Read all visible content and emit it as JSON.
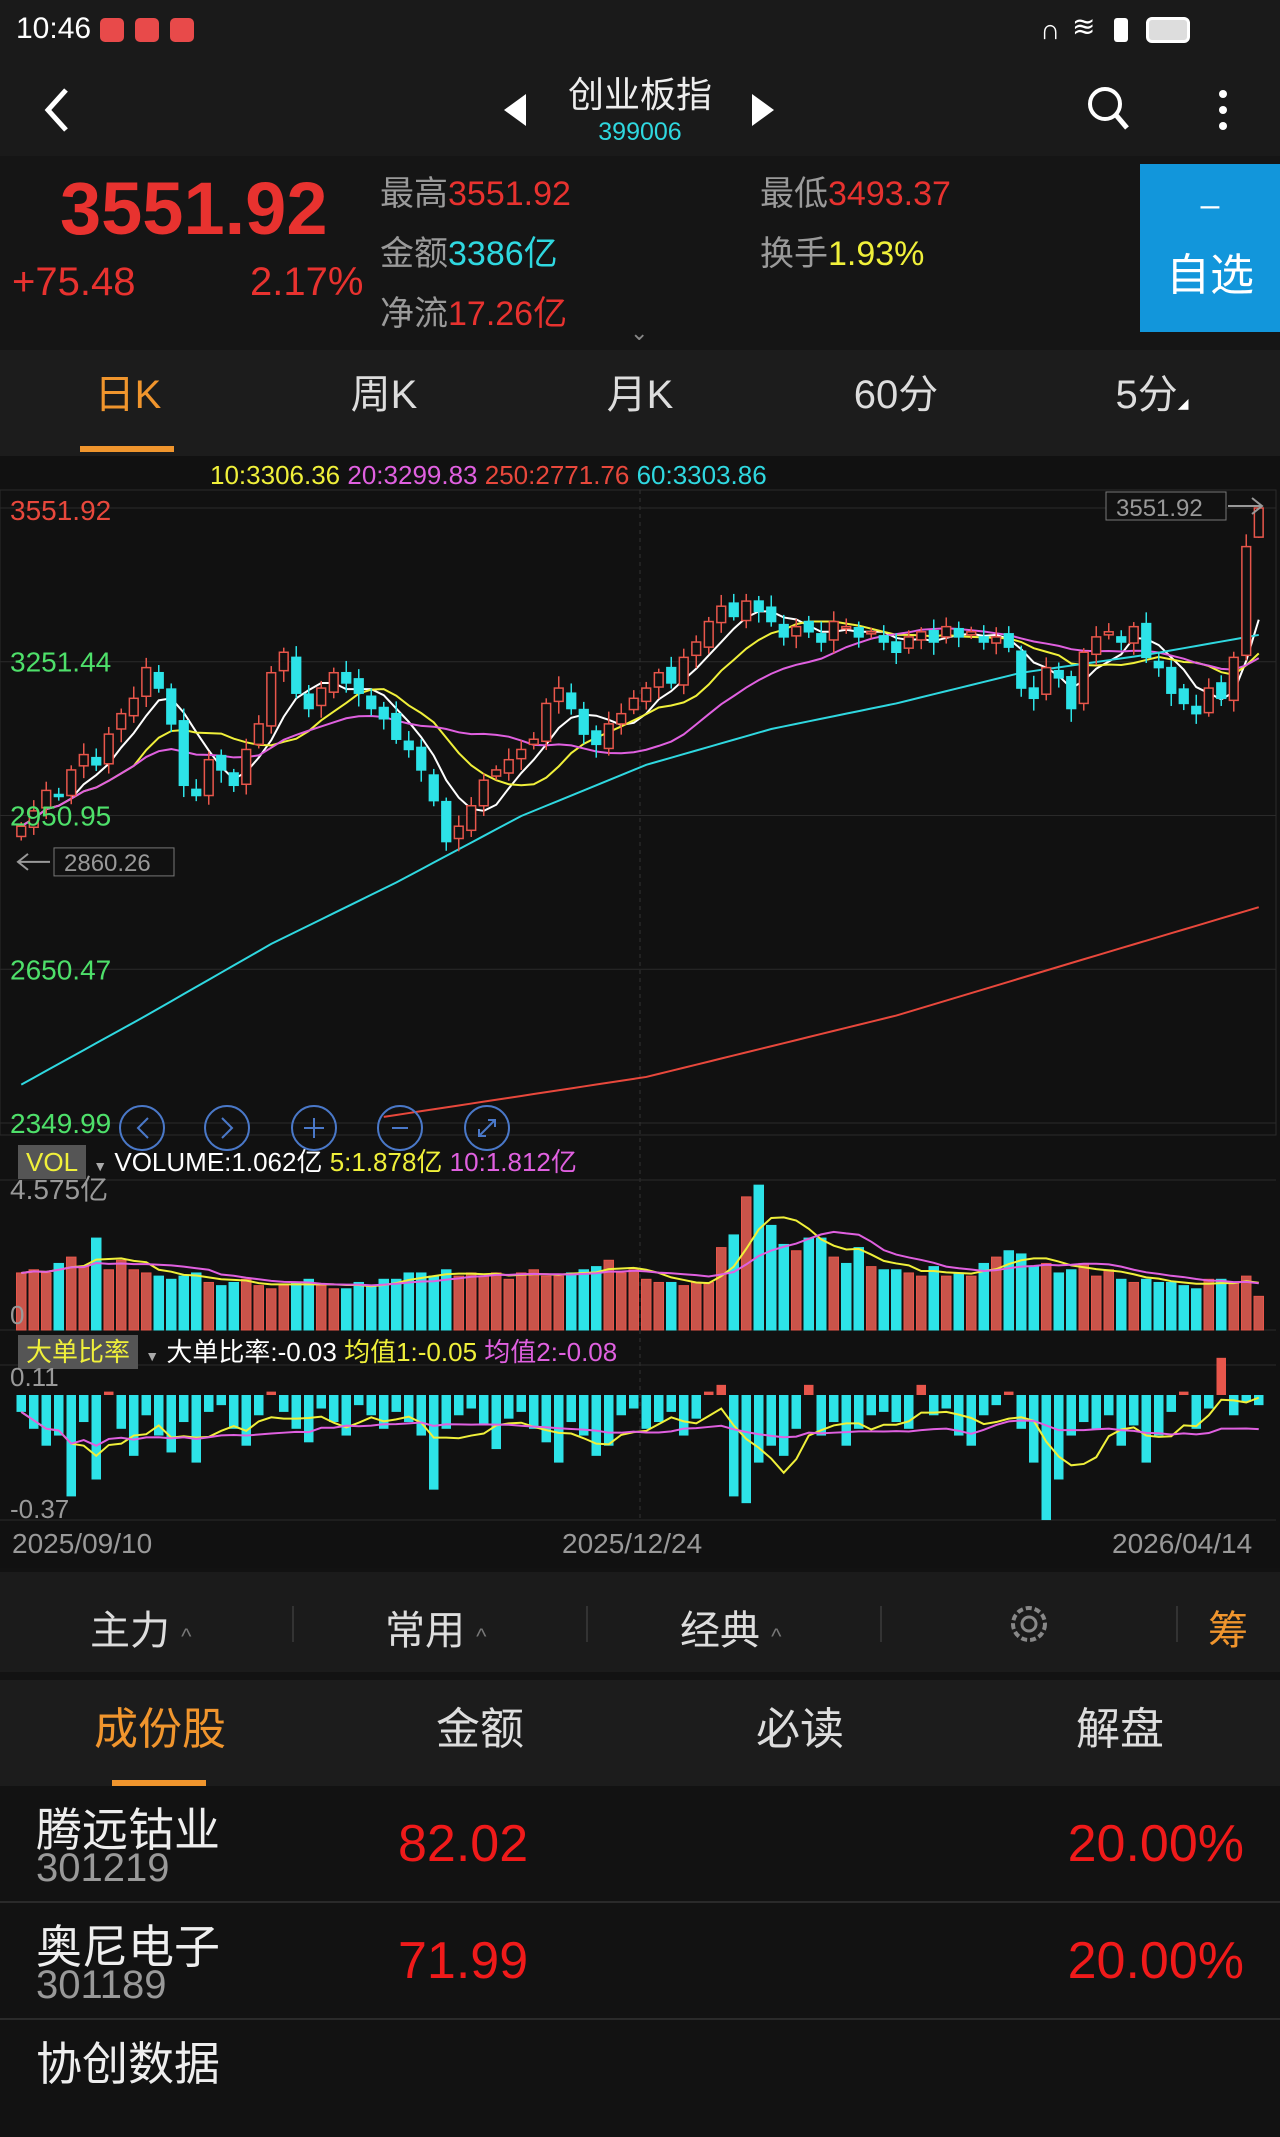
{
  "status_bar": {
    "time": "10:46"
  },
  "header": {
    "title": "创业板指",
    "code": "399006"
  },
  "quote": {
    "price": "3551.92",
    "change": "+75.48",
    "change_pct": "2.17%",
    "high_label": "最高",
    "high": "3551.92",
    "low_label": "最低",
    "low": "3493.37",
    "amount_label": "金额",
    "amount": "3386亿",
    "turnover_label": "换手",
    "turnover": "1.93%",
    "netflow_label": "净流",
    "netflow": "17.26亿",
    "watch_minus": "–",
    "watch_label": "自选"
  },
  "period_tabs": [
    {
      "label": "日K",
      "active": true
    },
    {
      "label": "周K"
    },
    {
      "label": "月K"
    },
    {
      "label": "60分"
    },
    {
      "label": "5分"
    }
  ],
  "ma_legend": {
    "ma10": "10:3306.36",
    "ma20": "20:3299.83",
    "ma250": "250:2771.76",
    "ma60": "60:3303.86"
  },
  "colors": {
    "up": "#e8564b",
    "down": "#2de3e8",
    "ma5": "#ffffff",
    "ma10": "#f0f03a",
    "ma20": "#e060e0",
    "ma60": "#2fd8e0",
    "ma250": "#e8483c",
    "accent": "#f0952d",
    "watch_bg": "#1296db"
  },
  "chart_data": {
    "type": "candlestick",
    "y_ticks": [
      "3551.92",
      "3251.44",
      "2950.95",
      "2650.47",
      "2349.99"
    ],
    "ylim": [
      2349.99,
      3551.92
    ],
    "max_marker": "3551.92",
    "min_marker": "2860.26",
    "x_labels": [
      "2025/09/10",
      "2025/12/24",
      "2026/04/14"
    ],
    "closes": [
      2930,
      2960,
      3000,
      2990,
      3040,
      3070,
      3050,
      3110,
      3150,
      3180,
      3240,
      3200,
      3130,
      3010,
      2990,
      3060,
      3040,
      3010,
      3080,
      3130,
      3230,
      3270,
      3190,
      3160,
      3200,
      3230,
      3210,
      3190,
      3160,
      3140,
      3100,
      3080,
      3040,
      2980,
      2900,
      2930,
      2970,
      3020,
      3040,
      3060,
      3080,
      3100,
      3170,
      3200,
      3160,
      3110,
      3090,
      3130,
      3150,
      3180,
      3200,
      3230,
      3210,
      3260,
      3290,
      3330,
      3360,
      3340,
      3370,
      3350,
      3330,
      3300,
      3320,
      3310,
      3290,
      3330,
      3320,
      3300,
      3310,
      3290,
      3270,
      3300,
      3310,
      3290,
      3320,
      3300,
      3310,
      3290,
      3300,
      3280,
      3200,
      3180,
      3240,
      3220,
      3160,
      3270,
      3300,
      3310,
      3290,
      3320,
      3260,
      3240,
      3190,
      3170,
      3150,
      3200,
      3180,
      3260,
      3476.44,
      3551.92
    ],
    "ma60_keypoints": [
      [
        0,
        2425
      ],
      [
        10,
        2560
      ],
      [
        20,
        2700
      ],
      [
        30,
        2820
      ],
      [
        40,
        2950
      ],
      [
        50,
        3050
      ],
      [
        60,
        3120
      ],
      [
        70,
        3170
      ],
      [
        80,
        3230
      ],
      [
        90,
        3265
      ],
      [
        99,
        3303.86
      ]
    ],
    "ma250_keypoints": [
      [
        29,
        2362
      ],
      [
        50,
        2440
      ],
      [
        70,
        2560
      ],
      [
        85,
        2670
      ],
      [
        99,
        2771.76
      ]
    ],
    "volume": {
      "label": "VOL",
      "legend": "VOLUME:1.062亿",
      "ma5": "5:1.878亿",
      "ma10": "10:1.812亿",
      "top_label": "4.575亿",
      "bottom_label": "0",
      "max": 4.575,
      "values": [
        1.8,
        1.9,
        1.8,
        2.1,
        2.3,
        2.0,
        2.9,
        1.9,
        2.2,
        1.9,
        1.8,
        1.7,
        1.6,
        1.7,
        1.8,
        1.5,
        1.4,
        1.5,
        1.6,
        1.4,
        1.3,
        1.4,
        1.5,
        1.6,
        1.4,
        1.3,
        1.3,
        1.5,
        1.4,
        1.6,
        1.6,
        1.8,
        1.8,
        1.7,
        1.9,
        1.7,
        1.8,
        1.7,
        1.8,
        1.6,
        1.8,
        1.9,
        1.7,
        1.7,
        1.8,
        1.9,
        2.0,
        2.2,
        1.8,
        1.9,
        1.6,
        1.5,
        1.5,
        1.4,
        1.5,
        1.5,
        2.6,
        3.0,
        4.2,
        4.57,
        3.3,
        2.7,
        2.5,
        2.9,
        2.9,
        2.3,
        2.1,
        2.6,
        2.0,
        1.9,
        1.9,
        1.8,
        1.7,
        2.0,
        1.7,
        1.8,
        1.7,
        2.1,
        2.3,
        2.5,
        2.4,
        2.0,
        2.1,
        1.8,
        1.9,
        2.1,
        1.7,
        1.9,
        1.6,
        1.5,
        1.6,
        1.5,
        1.5,
        1.4,
        1.3,
        1.6,
        1.6,
        1.5,
        1.7,
        1.062
      ]
    },
    "ratio": {
      "label": "大单比率",
      "legend": "大单比率:-0.03",
      "avg1": "均值1:-0.05",
      "avg2": "均值2:-0.08",
      "top_label": "0.11",
      "bottom_label": "-0.37",
      "values": [
        -0.05,
        -0.1,
        -0.15,
        -0.12,
        -0.3,
        -0.08,
        -0.25,
        0.01,
        -0.1,
        -0.18,
        -0.06,
        -0.12,
        -0.17,
        -0.08,
        -0.2,
        -0.05,
        -0.03,
        -0.1,
        -0.15,
        -0.06,
        0.01,
        -0.05,
        -0.1,
        -0.14,
        -0.04,
        -0.08,
        -0.12,
        -0.03,
        -0.06,
        -0.1,
        -0.05,
        -0.08,
        -0.12,
        -0.28,
        -0.1,
        -0.06,
        -0.04,
        -0.09,
        -0.16,
        -0.07,
        -0.05,
        -0.1,
        -0.14,
        -0.2,
        -0.08,
        -0.12,
        -0.18,
        -0.15,
        -0.06,
        -0.04,
        -0.1,
        -0.08,
        -0.05,
        -0.12,
        -0.07,
        0.01,
        0.03,
        -0.3,
        -0.32,
        -0.2,
        -0.15,
        -0.18,
        -0.1,
        0.03,
        -0.12,
        -0.08,
        -0.15,
        -0.1,
        -0.06,
        -0.05,
        -0.08,
        -0.1,
        0.03,
        -0.06,
        -0.04,
        -0.12,
        -0.15,
        -0.06,
        -0.03,
        0.01,
        -0.1,
        -0.2,
        -0.37,
        -0.25,
        -0.12,
        -0.08,
        -0.1,
        -0.06,
        -0.15,
        -0.09,
        -0.2,
        -0.12,
        -0.05,
        0.01,
        -0.1,
        -0.04,
        0.11,
        -0.06,
        -0.02,
        -0.03
      ]
    }
  },
  "toolbar": [
    {
      "label": "主力"
    },
    {
      "label": "常用"
    },
    {
      "label": "经典"
    }
  ],
  "toolbar_chip": "筹",
  "list_tabs": [
    {
      "label": "成份股",
      "active": true
    },
    {
      "label": "金额"
    },
    {
      "label": "必读"
    },
    {
      "label": "解盘"
    }
  ],
  "stocks": [
    {
      "name": "腾远钴业",
      "code": "301219",
      "price": "82.02",
      "pct": "20.00%"
    },
    {
      "name": "奥尼电子",
      "code": "301189",
      "price": "71.99",
      "pct": "20.00%"
    },
    {
      "name": "协创数据"
    }
  ]
}
